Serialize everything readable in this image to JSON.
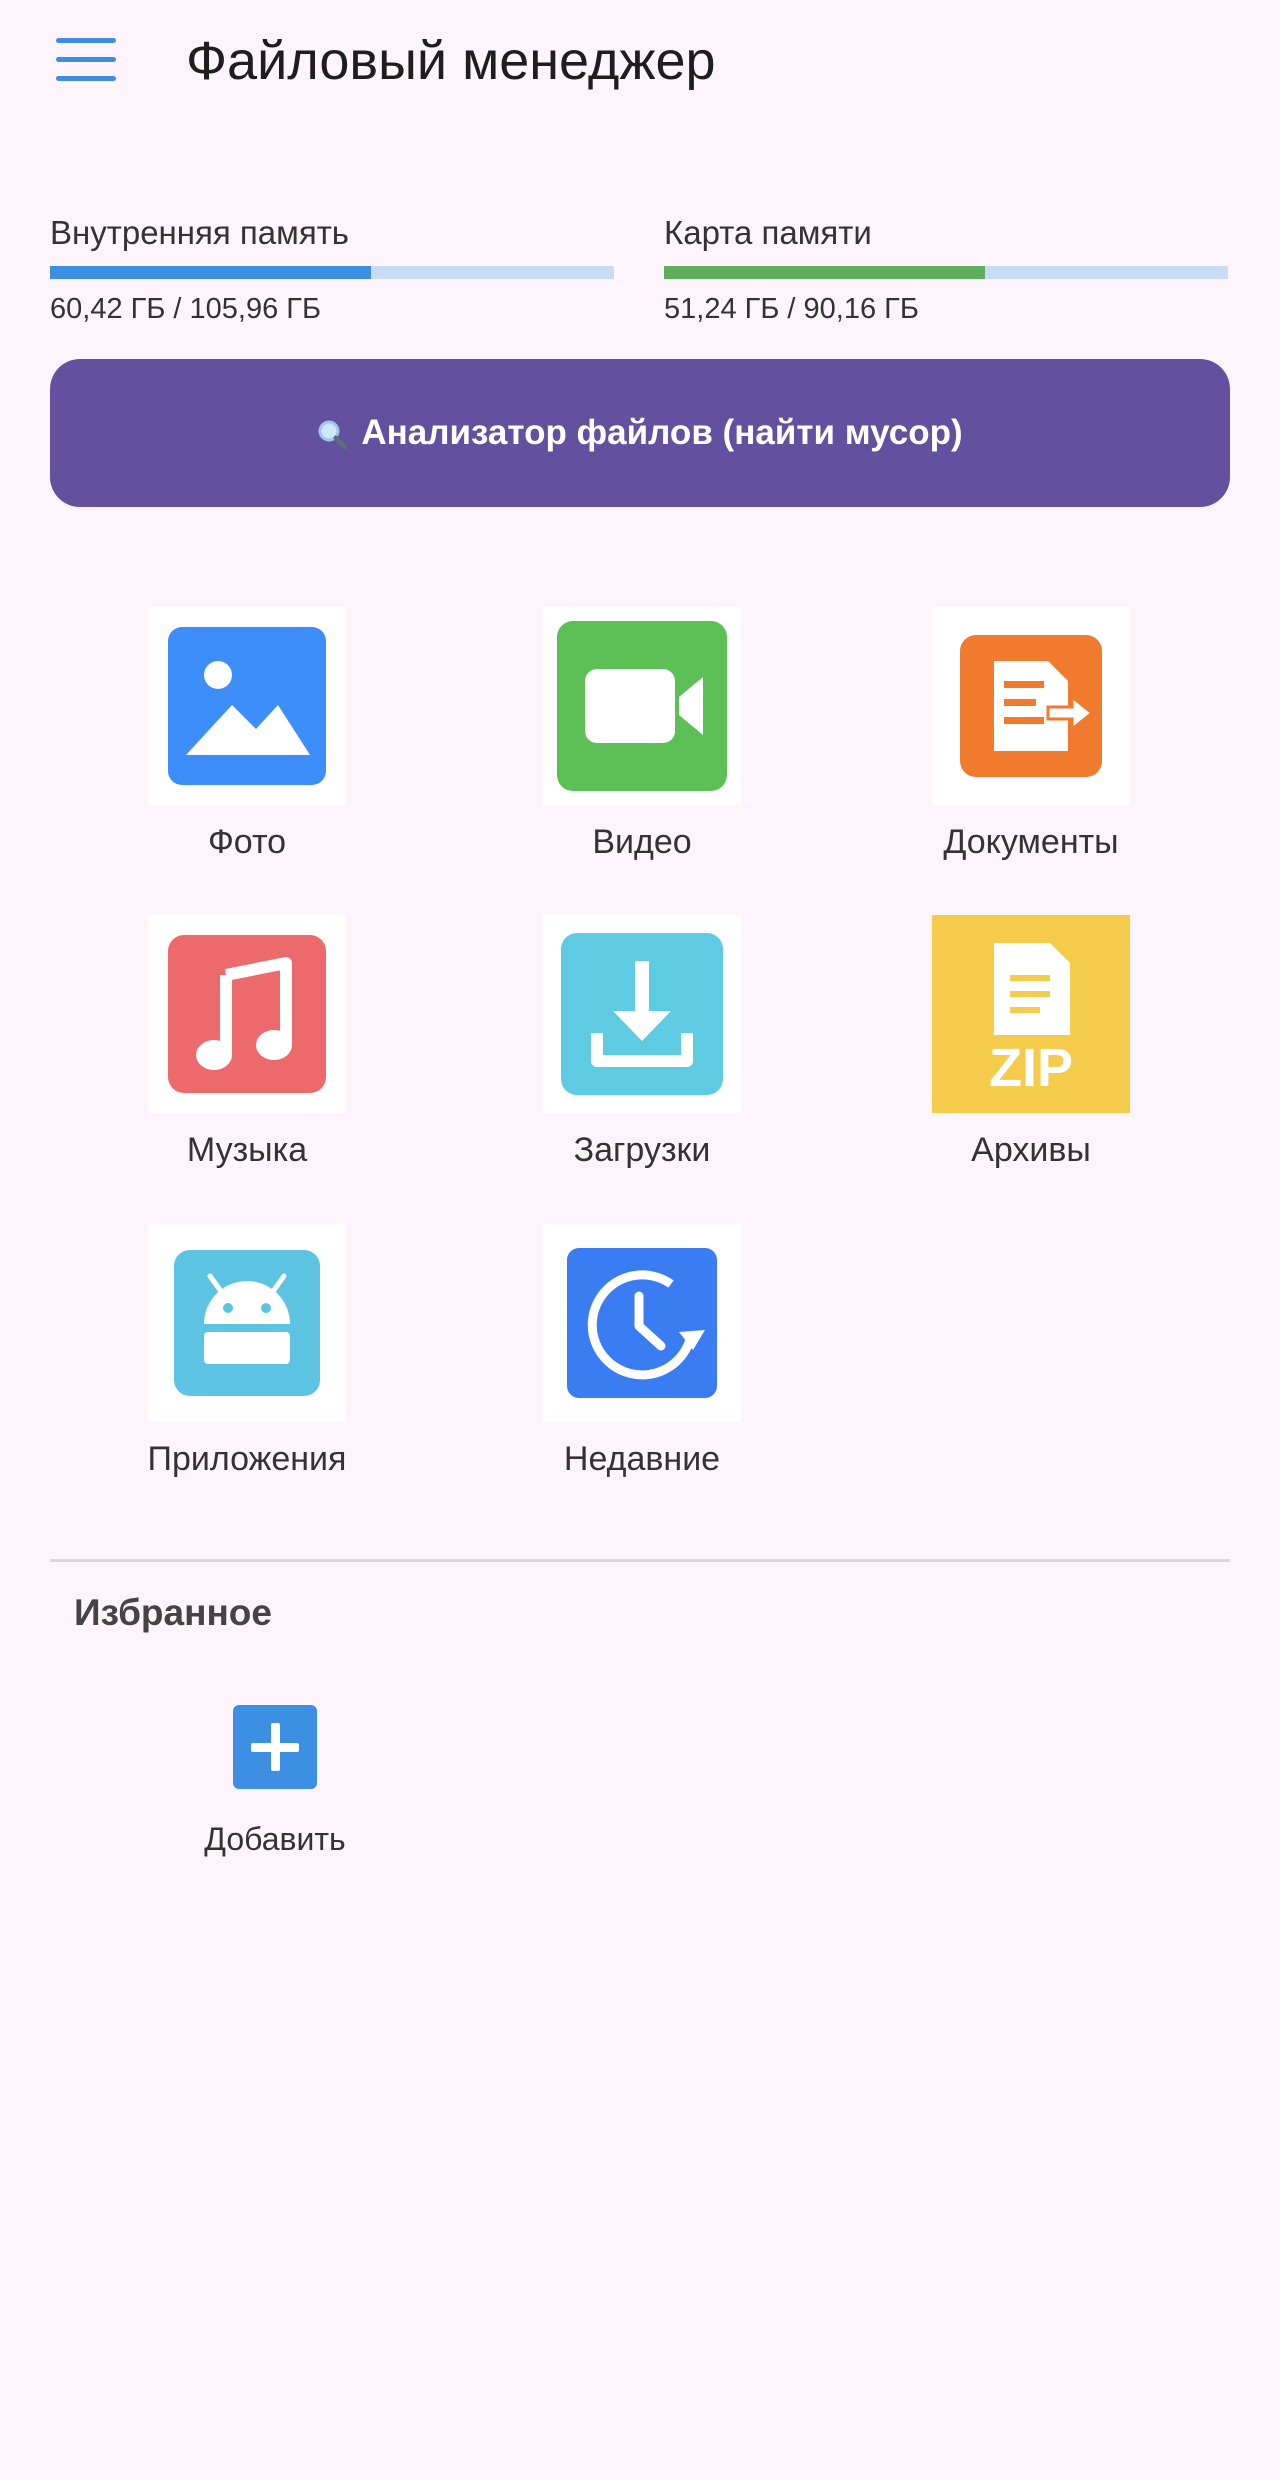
{
  "header": {
    "title": "Файловый менеджер",
    "menu_icon": "hamburger-menu-icon"
  },
  "storage": [
    {
      "label": "Внутренняя память",
      "usage": "60,42 ГБ / 105,96 ГБ",
      "fill_fraction": 0.57,
      "color": "#3d8fe4"
    },
    {
      "label": "Карта памяти",
      "usage": "51,24 ГБ / 90,16 ГБ",
      "fill_fraction": 0.57,
      "color": "#5fae5c"
    }
  ],
  "analyzer": {
    "label": "Анализатор файлов (найти мусор)",
    "icon": "magnifier-icon",
    "color": "#6351a0"
  },
  "categories": [
    {
      "label": "Фото",
      "icon": "photo-icon",
      "color": "#3d8ef8"
    },
    {
      "label": "Видео",
      "icon": "video-icon",
      "color": "#5cc056"
    },
    {
      "label": "Документы",
      "icon": "document-icon",
      "color": "#f07a2e"
    },
    {
      "label": "Музыка",
      "icon": "music-icon",
      "color": "#ec6a6c"
    },
    {
      "label": "Загрузки",
      "icon": "download-icon",
      "color": "#5ecbe2"
    },
    {
      "label": "Архивы",
      "icon": "zip-archive-icon",
      "color": "#f5cb4b",
      "badge": "ZIP"
    },
    {
      "label": "Приложения",
      "icon": "android-icon",
      "color": "#5cc3e3"
    },
    {
      "label": "Недавние",
      "icon": "recent-clock-icon",
      "color": "#3a7cf2"
    }
  ],
  "favorites": {
    "title": "Избранное",
    "add_label": "Добавить",
    "add_icon": "plus-icon"
  }
}
